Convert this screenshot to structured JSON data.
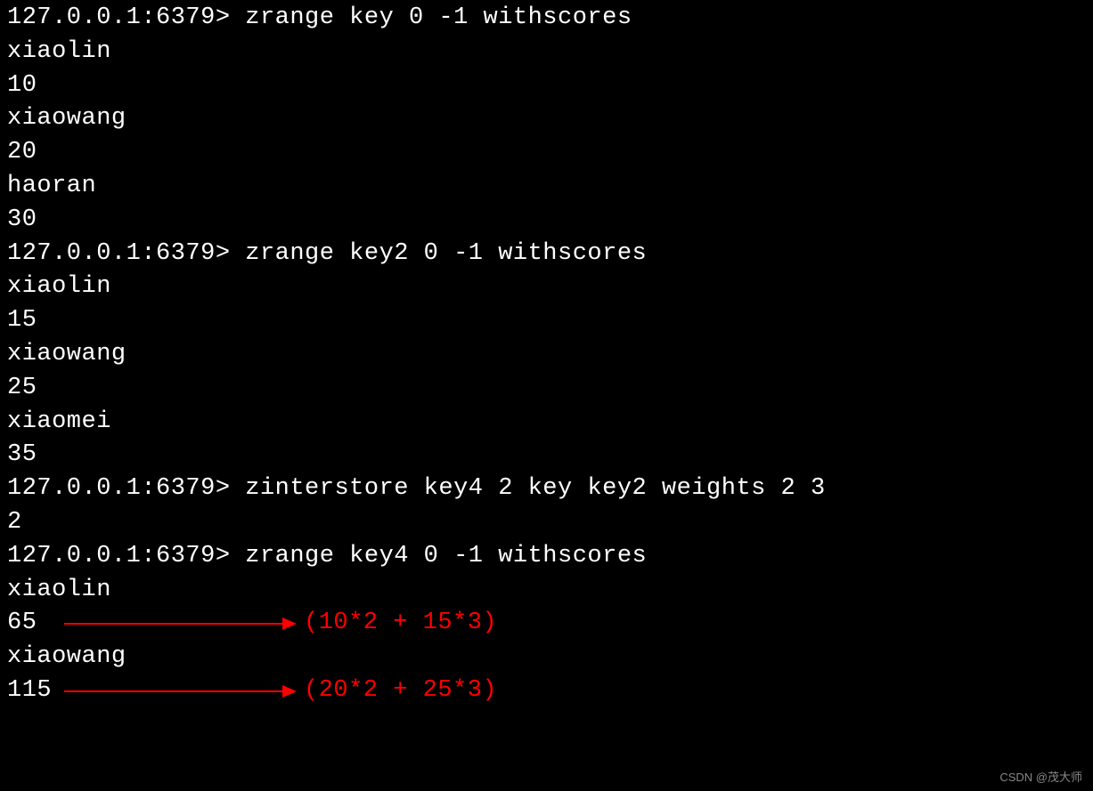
{
  "prompt": "127.0.0.1:6379> ",
  "commands": {
    "cmd1": "zrange key 0 -1 withscores",
    "cmd2": "zrange key2 0 -1 withscores",
    "cmd3": "zinterstore key4 2 key key2 weights 2 3",
    "cmd4": "zrange key4 0 -1 withscores"
  },
  "outputs": {
    "key_members": [
      {
        "member": "xiaolin",
        "score": "10"
      },
      {
        "member": "xiaowang",
        "score": "20"
      },
      {
        "member": "haoran",
        "score": "30"
      }
    ],
    "key2_members": [
      {
        "member": "xiaolin",
        "score": "15"
      },
      {
        "member": "xiaowang",
        "score": "25"
      },
      {
        "member": "xiaomei",
        "score": "35"
      }
    ],
    "zinterstore_result": "2",
    "key4_members": [
      {
        "member": "xiaolin",
        "score": "65",
        "explanation": "(10*2 + 15*3)"
      },
      {
        "member": "xiaowang",
        "score": "115",
        "explanation": "(20*2 + 25*3)"
      }
    ]
  },
  "watermark": "CSDN @茂大师"
}
